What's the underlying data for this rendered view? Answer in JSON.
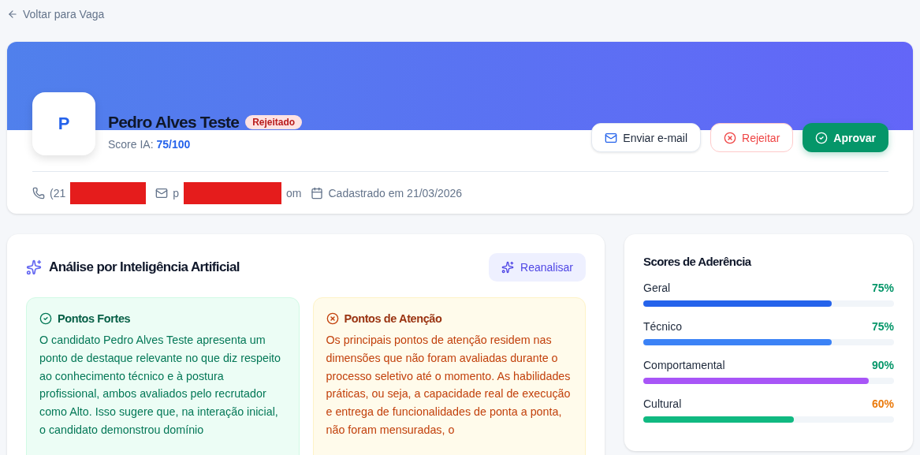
{
  "back_link": {
    "label": "Voltar para Vaga"
  },
  "candidate": {
    "initial": "P",
    "name": "Pedro Alves Teste",
    "status": "Rejeitado",
    "score_label": "Score IA:",
    "score_value": "75/100"
  },
  "actions": [
    {
      "kind": "outline",
      "label": "Enviar e-mail"
    },
    {
      "kind": "danger",
      "label": "Rejeitar"
    },
    {
      "kind": "primary",
      "label": "Aprovar"
    }
  ],
  "contact": {
    "phone": "(21",
    "email_start": "p",
    "email_end": "om",
    "registered": "Cadastrado em 21/03/2026"
  },
  "analysis": {
    "title": "Análise por Inteligência Artificial",
    "reanalyze_button": "Reanalisar",
    "cards": [
      {
        "kind": "strengths",
        "title": "Pontos Fortes",
        "text": "O candidato Pedro Alves Teste apresenta um ponto de destaque relevante no que diz respeito ao conhecimento técnico e à postura profissional, ambos avaliados pelo recrutador como Alto. Isso sugere que, na interação inicial, o candidato demonstrou domínio"
      },
      {
        "kind": "concerns",
        "title": "Pontos de Atenção",
        "text": "Os principais pontos de atenção residem nas dimensões que não foram avaliadas durante o processo seletivo até o momento. As habilidades práticas, ou seja, a capacidade real de execução e entrega de funcionalidades de ponta a ponta, não foram mensuradas, o"
      }
    ]
  },
  "scores": {
    "title": "Scores de Aderência",
    "items": [
      {
        "label": "Geral",
        "value": "75%",
        "level": 0.75,
        "color": "#2563eb",
        "kind": "good"
      },
      {
        "label": "Técnico",
        "value": "75%",
        "level": 0.75,
        "color": "#3b82f6",
        "kind": "good"
      },
      {
        "label": "Comportamental",
        "value": "90%",
        "level": 0.9,
        "color": "#a855f7",
        "kind": "good"
      },
      {
        "label": "Cultural",
        "value": "60%",
        "level": 0.6,
        "color": "#10b981",
        "kind": "warn"
      }
    ]
  }
}
